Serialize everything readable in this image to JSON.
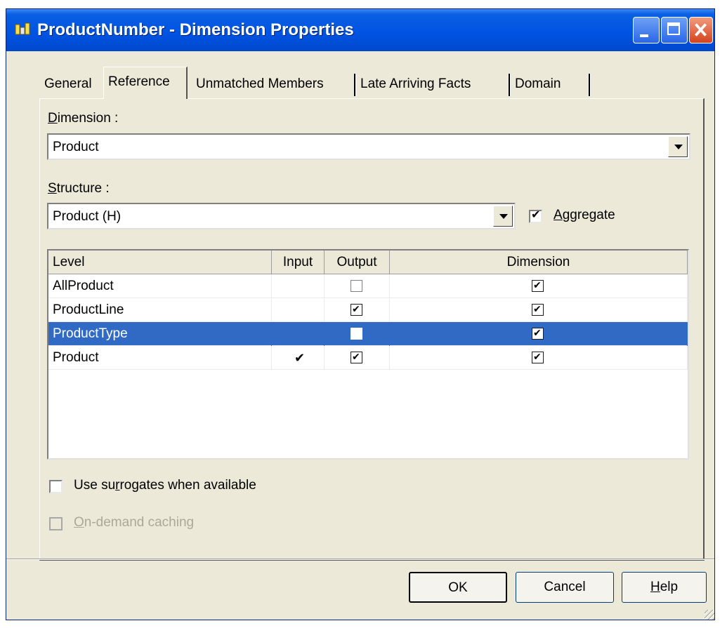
{
  "window": {
    "title": "ProductNumber - Dimension Properties"
  },
  "tabs": [
    {
      "label": "General",
      "active": false
    },
    {
      "label": "Reference",
      "active": true
    },
    {
      "label": "Unmatched Members",
      "active": false
    },
    {
      "label": "Late Arriving Facts",
      "active": false
    },
    {
      "label": "Domain",
      "active": false
    }
  ],
  "dimension": {
    "label_mnemonic": "D",
    "label_rest": "imension :",
    "value": "Product"
  },
  "structure": {
    "label_mnemonic": "S",
    "label_rest": "tructure :",
    "value": "Product (H)"
  },
  "aggregate": {
    "label_mnemonic": "A",
    "label_rest": "ggregate",
    "checked": true
  },
  "grid": {
    "columns": {
      "level": "Level",
      "input": "Input",
      "output": "Output",
      "dimension": "Dimension"
    },
    "rows": [
      {
        "level": "AllProduct",
        "input": false,
        "output": false,
        "dimension": true,
        "selected": false
      },
      {
        "level": "ProductLine",
        "input": false,
        "output": true,
        "dimension": true,
        "selected": false
      },
      {
        "level": "ProductType",
        "input": false,
        "output": false,
        "dimension": true,
        "selected": true
      },
      {
        "level": "Product",
        "input": true,
        "output": true,
        "dimension": true,
        "selected": false
      }
    ]
  },
  "options": {
    "surrogates": {
      "pre": "Use su",
      "mnemonic": "r",
      "post": "rogates when available",
      "checked": false
    },
    "caching": {
      "mnemonic": "O",
      "post": "n-demand caching",
      "checked": false,
      "disabled": true
    }
  },
  "buttons": {
    "ok": "OK",
    "cancel": "Cancel",
    "help_mnemonic": "H",
    "help_rest": "elp"
  },
  "colors": {
    "titlebar": "#0054e3",
    "selection": "#316ac5",
    "face": "#ece9d8"
  }
}
